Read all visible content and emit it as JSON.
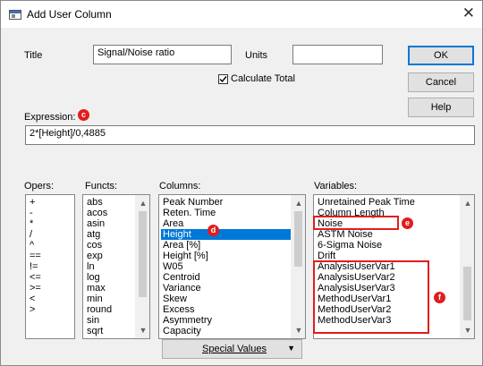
{
  "window": {
    "title": "Add User Column",
    "close_symbol": "✕"
  },
  "form": {
    "title_label": "Title",
    "title_value": "Signal/Noise ratio",
    "units_label": "Units",
    "units_value": "",
    "calc_total_label": "Calculate Total",
    "calc_total_checked": true,
    "expression_label": "Expression:",
    "expression_value": "2*[Height]/0,4885"
  },
  "buttons": {
    "ok": "OK",
    "cancel": "Cancel",
    "help": "Help"
  },
  "opers": {
    "label": "Opers:",
    "items": [
      "+",
      "-",
      "*",
      "/",
      "^",
      "==",
      "!=",
      "<=",
      ">=",
      "<",
      ">"
    ]
  },
  "functs": {
    "label": "Functs:",
    "items": [
      "abs",
      "acos",
      "asin",
      "atg",
      "cos",
      "exp",
      "ln",
      "log",
      "max",
      "min",
      "round",
      "sin",
      "sqrt"
    ]
  },
  "columns": {
    "label": "Columns:",
    "items": [
      "Peak Number",
      "Reten. Time",
      "Area",
      "Height",
      "Area [%]",
      "Height [%]",
      "W05",
      "Centroid",
      "Variance",
      "Skew",
      "Excess",
      "Asymmetry",
      "Capacity"
    ],
    "selected_index": 3
  },
  "variables": {
    "label": "Variables:",
    "items": [
      "Unretained Peak Time",
      "Column Length",
      "Noise",
      "ASTM Noise",
      "6-Sigma Noise",
      "Drift",
      "AnalysisUserVar1",
      "AnalysisUserVar2",
      "AnalysisUserVar3",
      "MethodUserVar1",
      "MethodUserVar2",
      "MethodUserVar3"
    ]
  },
  "special_values": {
    "label": "Special Values"
  },
  "annotations": {
    "c": "c",
    "d": "d",
    "e": "e",
    "f": "f"
  },
  "colors": {
    "accent": "#0078d7",
    "annotation_red": "#e11d1d"
  }
}
